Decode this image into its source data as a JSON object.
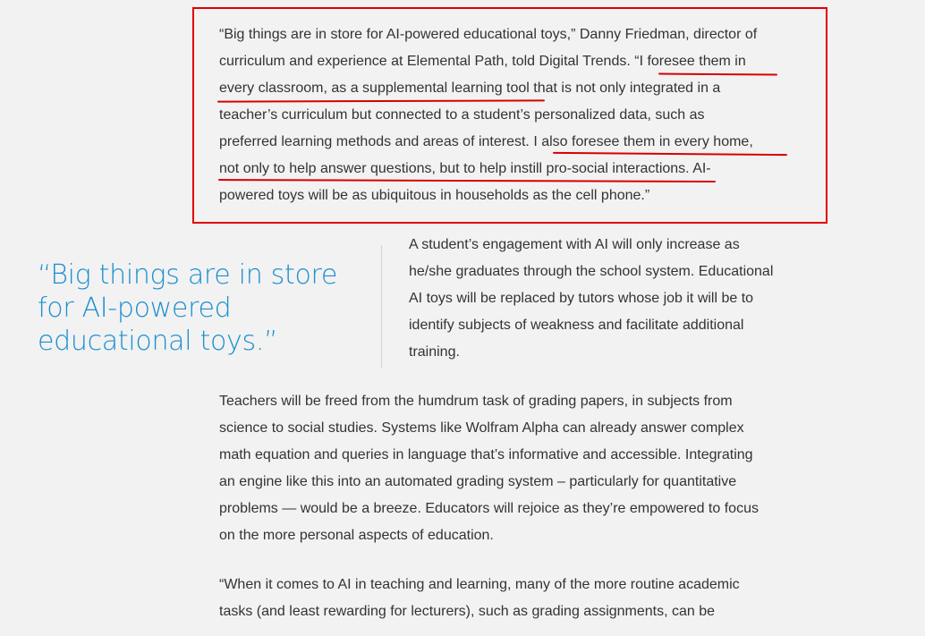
{
  "quote_block": {
    "lines": [
      "“Big things are in store for AI-powered educational toys,” Danny Friedman, director of",
      "curriculum and experience at Elemental Path, told Digital Trends. “I foresee them in",
      "every classroom, as a supplemental learning tool that is not only integrated in a",
      "teacher’s curriculum but connected to a student’s personalized data, such as",
      "preferred learning methods and areas of interest. I also foresee them in every home,",
      "not only to help answer questions, but to help instill pro-social interactions. AI-",
      "powered toys will be as ubiquitous in households as the cell phone.”"
    ]
  },
  "pull_quote": {
    "text": "“Big things are in store for AI-powered educational toys.”"
  },
  "side_paragraph": {
    "lines": [
      "A student’s engagement with AI will only increase as",
      "he/she graduates through the school system. Educational",
      "AI toys will be replaced by tutors whose job it will be to",
      "identify subjects of weakness and facilitate additional",
      "training."
    ]
  },
  "paragraph_teachers": {
    "lines": [
      "Teachers will be freed from the humdrum task of grading papers, in subjects from",
      "science to social studies. Systems like Wolfram Alpha can already answer complex",
      "math equation and queries in language that’s informative and accessible. Integrating",
      "an engine like this into an automated grading system – particularly for quantitative",
      "problems — would be a breeze. Educators will rejoice as they’re empowered to focus",
      "on the more personal aspects of education."
    ]
  },
  "paragraph_ai_teaching": {
    "lines": [
      "“When it comes to AI in teaching and learning, many of the more routine academic",
      "tasks (and least rewarding for lecturers), such as grading assignments, can be"
    ]
  },
  "colors": {
    "annotation_red": "#e00000",
    "pull_quote_blue": "#1b8fd0",
    "body_text": "#333333",
    "background": "#f2f2f2"
  }
}
